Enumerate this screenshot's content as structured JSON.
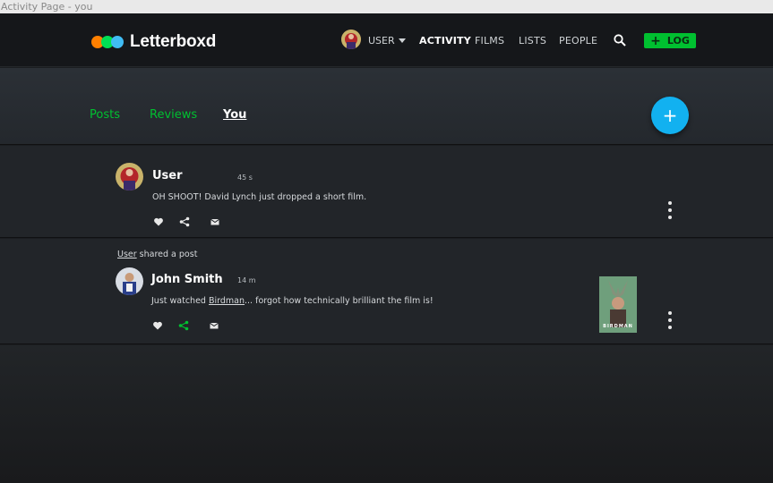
{
  "window": {
    "title": "Activity Page - you"
  },
  "brand": {
    "name": "Letterboxd"
  },
  "nav": {
    "user_label": "USER",
    "links": [
      "ACTIVITY",
      "FILMS",
      "LISTS",
      "PEOPLE"
    ],
    "log_label": "LOG",
    "log_plus": "+"
  },
  "tabs": [
    "Posts",
    "Reviews",
    "You"
  ],
  "fab": {
    "label": "+"
  },
  "posts": [
    {
      "author": "User",
      "time": "45 s",
      "text": "OH SHOOT! David Lynch just dropped a short film."
    },
    {
      "shared_by": "User",
      "shared_suffix": " shared a post",
      "author": "John Smith",
      "time": "14 m",
      "text_before": "Just watched ",
      "text_link": "Birdman",
      "text_after": "... forgot how technically brilliant the film is!",
      "poster_title": "BIRDMAN"
    }
  ],
  "colors": {
    "accent_green": "#00c030",
    "fab_blue": "#12b1f0",
    "shared_icon_green": "#00c030"
  }
}
